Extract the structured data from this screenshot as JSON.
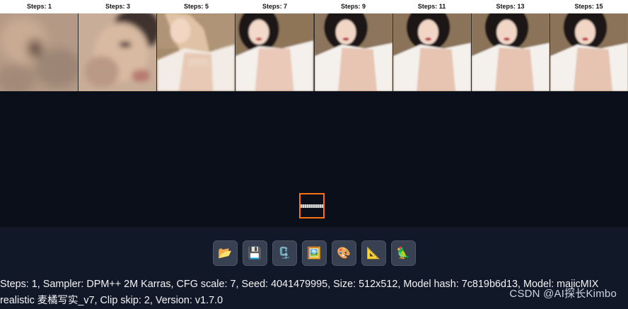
{
  "grid": {
    "labels": [
      "Steps: 1",
      "Steps: 3",
      "Steps: 5",
      "Steps: 7",
      "Steps: 9",
      "Steps: 11",
      "Steps: 13",
      "Steps: 15"
    ]
  },
  "toolbar": {
    "buttons": [
      {
        "name": "open-folder-button",
        "icon": "📂"
      },
      {
        "name": "save-button",
        "icon": "💾"
      },
      {
        "name": "zip-button",
        "icon": "🗜️"
      },
      {
        "name": "send-to-img2img-button",
        "icon": "🖼️"
      },
      {
        "name": "send-to-inpaint-button",
        "icon": "🎨"
      },
      {
        "name": "send-to-extras-button",
        "icon": "📐"
      },
      {
        "name": "send-to-other-button",
        "icon": "🦜"
      }
    ]
  },
  "info": {
    "text": "Steps: 1, Sampler: DPM++ 2M Karras, CFG scale: 7, Seed: 4041479995, Size: 512x512, Model hash: 7c819b6d13, Model: majicMIX realistic 麦橘写实_v7, Clip skip: 2, Version: v1.7.0"
  },
  "watermark": "CSDN @AI探长Kimbo"
}
